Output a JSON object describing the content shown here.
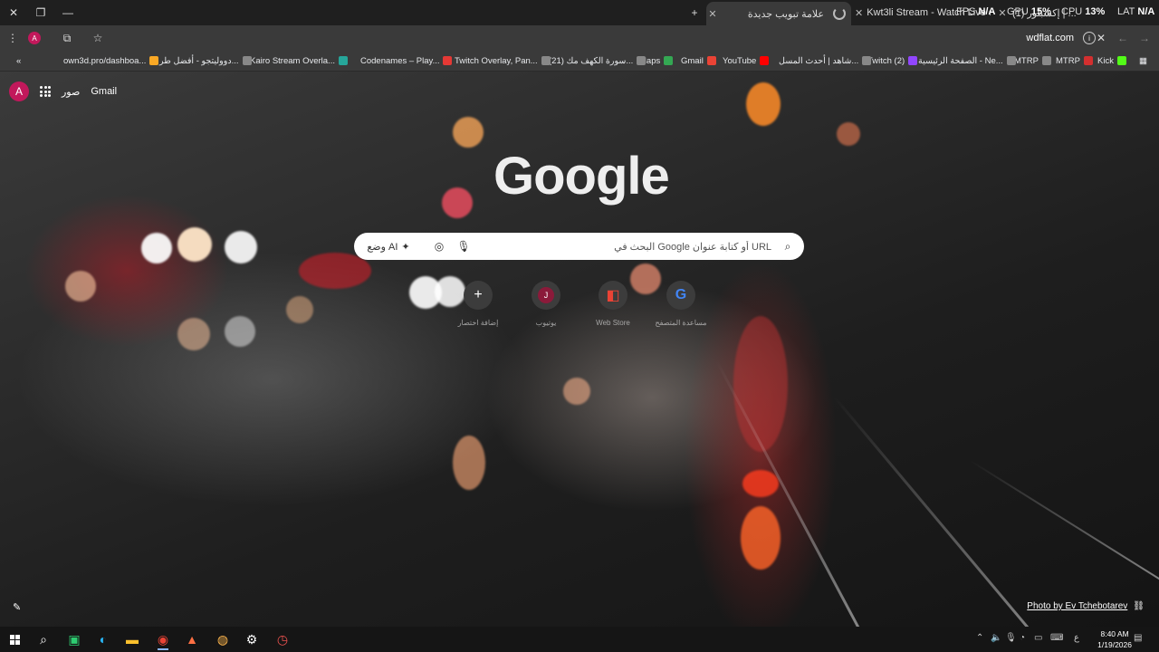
{
  "window": {
    "tabs": [
      {
        "title": "علامة تبويب جديدة",
        "active": true
      },
      {
        "title": "Kwt3li Stream - Watch Live on...",
        "active": false
      },
      {
        "title": "(1) إكسبلور | ...",
        "active": false
      }
    ],
    "perf": {
      "fps_label": "FPS",
      "fps_value": "N/A",
      "gpu_label": "GPU",
      "gpu_value": "15%",
      "cpu_label": "CPU",
      "cpu_value": "13%",
      "lat_label": "LAT",
      "lat_value": "N/A"
    }
  },
  "toolbar": {
    "url": "wdflat.com",
    "profile_initial": "A"
  },
  "bookmarks": [
    {
      "label": "Kick",
      "color": "#53fc18"
    },
    {
      "label": "MTRP",
      "color": "#d32f2f"
    },
    {
      "label": "MTRP",
      "color": "#888888"
    },
    {
      "label": "الصفحة الرئيسية - Ne...",
      "color": "#888888"
    },
    {
      "label": "Twitch (2)",
      "color": "#9146ff"
    },
    {
      "label": "شاهد | أحدث المسل...",
      "color": "#888888"
    },
    {
      "label": "YouTube",
      "color": "#ff0000"
    },
    {
      "label": "Gmail",
      "color": "#ea4335"
    },
    {
      "label": "Maps",
      "color": "#34a853"
    },
    {
      "label": "(21) سورة الكهف مك...",
      "color": "#888888"
    },
    {
      "label": "Twitch Overlay, Pan...",
      "color": "#888888"
    },
    {
      "label": "Codenames – Play...",
      "color": "#e53935"
    },
    {
      "label": "Kairo Stream Overla...",
      "color": "#26a69a"
    },
    {
      "label": "دووليتجو - أفضل طر...",
      "color": "#888888"
    },
    {
      "label": "own3d.pro/dashboa...",
      "color": "#f9a825"
    }
  ],
  "ntp": {
    "account_initial": "A",
    "gmail_label": "Gmail",
    "images_label": "صور",
    "logo_text": "Google",
    "search_placeholder": "البحث في Google أو كتابة عنوان URL",
    "ai_mode_label": "وضع AI",
    "shortcuts": [
      {
        "label": "مساعدة المتصفح",
        "icon": "G"
      },
      {
        "label": "Web Store",
        "icon": "◧"
      },
      {
        "label": "يوتيوب",
        "icon": "J"
      },
      {
        "label": "إضافة اختصار",
        "icon": "+"
      }
    ],
    "photo_credit": "Photo by Ev Tchebotarev"
  },
  "taskbar": {
    "time": "8:40 AM",
    "date": "1/19/2026",
    "lang": "ع"
  }
}
